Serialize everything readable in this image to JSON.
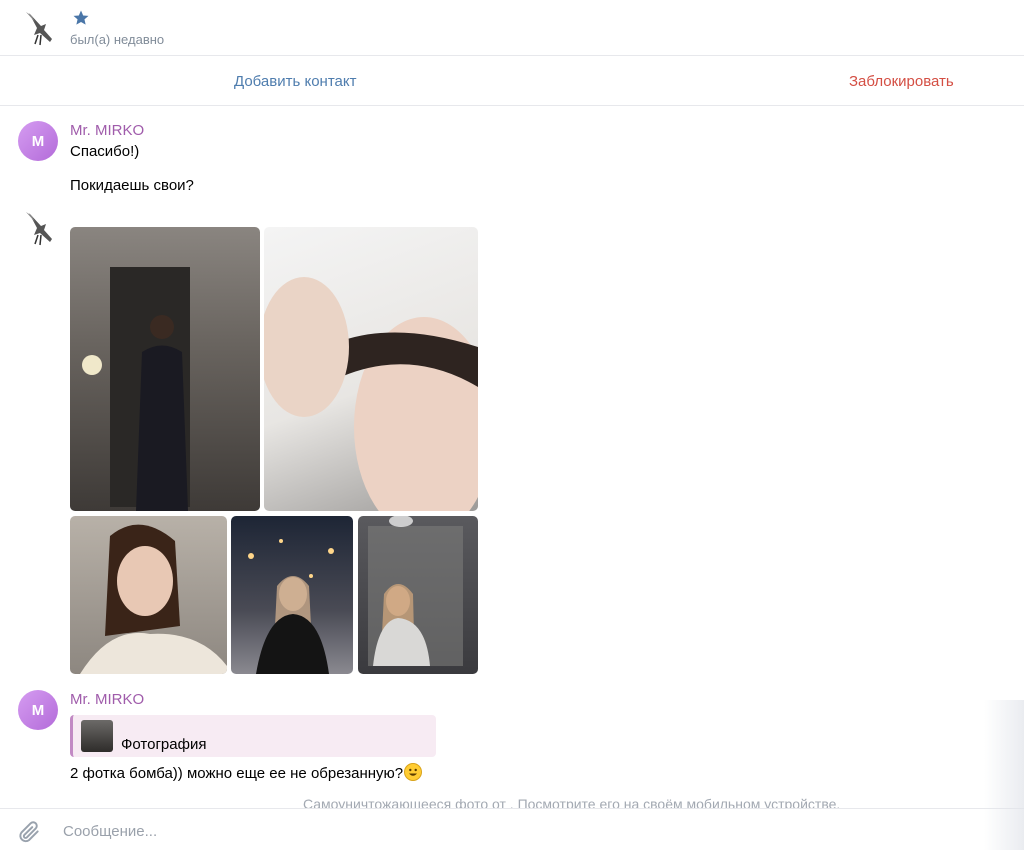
{
  "header": {
    "avatar_icon": "bird-avatar-icon",
    "star_icon": "star-icon",
    "star_color": "#4a76a8",
    "status": "был(а) недавно"
  },
  "actions": {
    "add_contact": "Добавить контакт",
    "block": "Заблокировать",
    "add_color": "#4f7dae",
    "block_color": "#d44f44"
  },
  "messages": [
    {
      "sender": "Mr. MIRKO",
      "avatar_letter": "M",
      "lines": [
        "Спасибо!)",
        "Покидаешь свои?"
      ]
    },
    {
      "sender_avatar_icon": "bird-avatar-icon",
      "photos": [
        {
          "description": "mirror-selfie-black-outfit"
        },
        {
          "description": "bath-selfie"
        },
        {
          "description": "selfie-white-top"
        },
        {
          "description": "winter-street-photo"
        },
        {
          "description": "mirror-selfie-grey-top"
        }
      ]
    },
    {
      "sender": "Mr. MIRKO",
      "avatar_letter": "M",
      "reply": {
        "label": "Фотография"
      },
      "text": "2 фотка бомба)) можно еще ее не обрезанную?",
      "emoji": "smiling-face-emoji"
    }
  ],
  "system_note": "Самоуничтожающееся фото от . Посмотрите его на своём мобильном устройстве.",
  "composer": {
    "placeholder": "Сообщение...",
    "attach_icon": "paperclip-icon"
  }
}
